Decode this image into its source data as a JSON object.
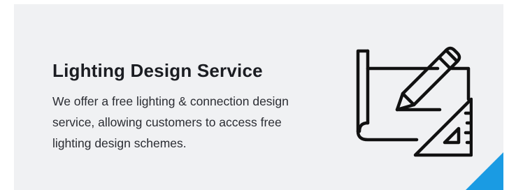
{
  "card": {
    "title": "Lighting Design Service",
    "description": "We offer a free lighting & connection design service, allowing customers to access free lighting design schemes.",
    "icon": "blueprint-pencil-set-square-icon",
    "accent_color": "#1a9be3",
    "background_color": "#f0f1f3"
  }
}
